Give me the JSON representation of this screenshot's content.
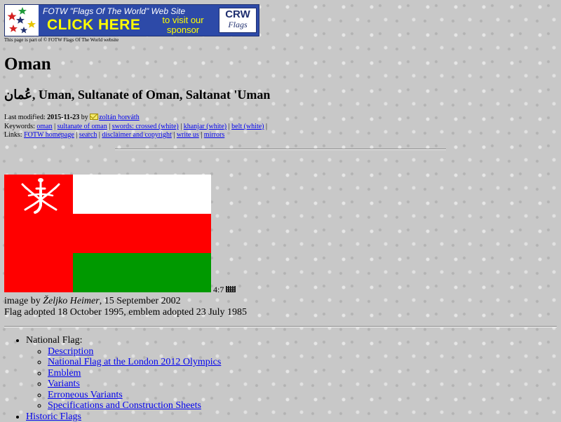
{
  "banner": {
    "top_line": "FOTW \"Flags Of The World\" Web Site",
    "click": "CLICK HERE",
    "visit": "to visit our sponsor",
    "crw_line1": "CRW",
    "crw_line2": "Flags"
  },
  "notice": "This page is part of © FOTW Flags Of The World website",
  "page_title": "Oman",
  "subtitle": "عُمان, Uman, Sultanate of Oman, Saltanat 'Uman",
  "meta": {
    "modified_label": "Last modified:",
    "modified_date": "2015-11-23",
    "by": "by",
    "author": "zoltán horváth",
    "keywords_label": "Keywords:",
    "keywords": [
      "oman",
      "sultanate of oman",
      "swords: crossed (white)",
      "khanjar (white)",
      "belt (white)"
    ],
    "links_label": "Links:",
    "links": [
      "FOTW homepage",
      "search",
      "disclaimer and copyright",
      "write us",
      "mirrors"
    ]
  },
  "flag": {
    "ratio": "4:7",
    "colors": {
      "red": "#ff0000",
      "white": "#ffffff",
      "green": "#009900"
    },
    "emblem_icon": "khanjar-emblem-icon"
  },
  "credit": {
    "prefix": "image by",
    "name": "Željko Heimer",
    "date": ", 15 September 2002"
  },
  "adopted": "Flag adopted 18 October 1995, emblem adopted 23 July 1985",
  "contents": {
    "national_flag_label": "National Flag:",
    "national_flag_items": [
      "Description",
      "National Flag at the London 2012 Olympics",
      "Emblem",
      "Variants",
      "Erroneous Variants",
      "Specifications and Construction Sheets"
    ],
    "historic_flags": "Historic Flags"
  }
}
